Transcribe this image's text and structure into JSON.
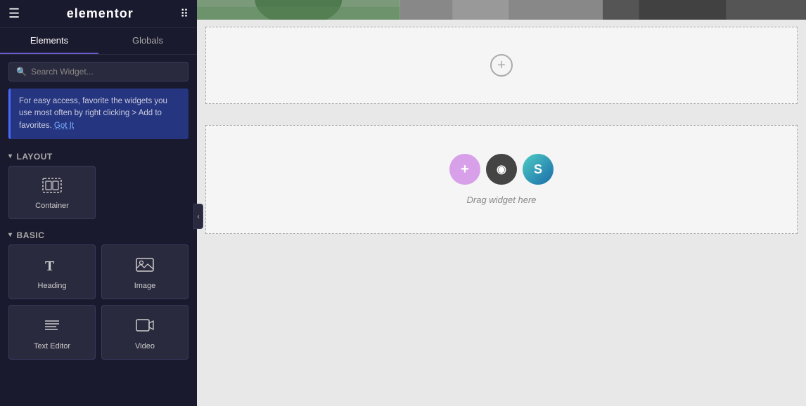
{
  "header": {
    "logo": "elementor",
    "hamburger_icon": "☰",
    "apps_icon": "⠿"
  },
  "tabs": {
    "elements_label": "Elements",
    "globals_label": "Globals",
    "active": "Elements"
  },
  "search": {
    "placeholder": "Search Widget...",
    "icon": "🔍"
  },
  "tip": {
    "text": "For easy access, favorite the widgets you use most often by right clicking > Add to favorites.",
    "link_text": "Got It",
    "underline_style": "dotted"
  },
  "layout_section": {
    "title": "Layout",
    "chevron": "▾"
  },
  "widgets": {
    "container": {
      "label": "Container",
      "icon": "container"
    },
    "heading": {
      "label": "Heading",
      "icon": "heading"
    },
    "image": {
      "label": "Image",
      "icon": "image"
    },
    "text_editor": {
      "label": "Text Editor",
      "icon": "text"
    },
    "video": {
      "label": "Video",
      "icon": "video"
    }
  },
  "basic_section": {
    "title": "Basic",
    "chevron": "▾"
  },
  "canvas": {
    "plus_icon": "+",
    "drag_text": "Drag widget here",
    "drag_icons": [
      {
        "type": "pink",
        "symbol": "+"
      },
      {
        "type": "dark",
        "symbol": "▣"
      },
      {
        "type": "blue-green",
        "symbol": "S"
      }
    ]
  },
  "collapse_handle": {
    "icon": "‹"
  }
}
